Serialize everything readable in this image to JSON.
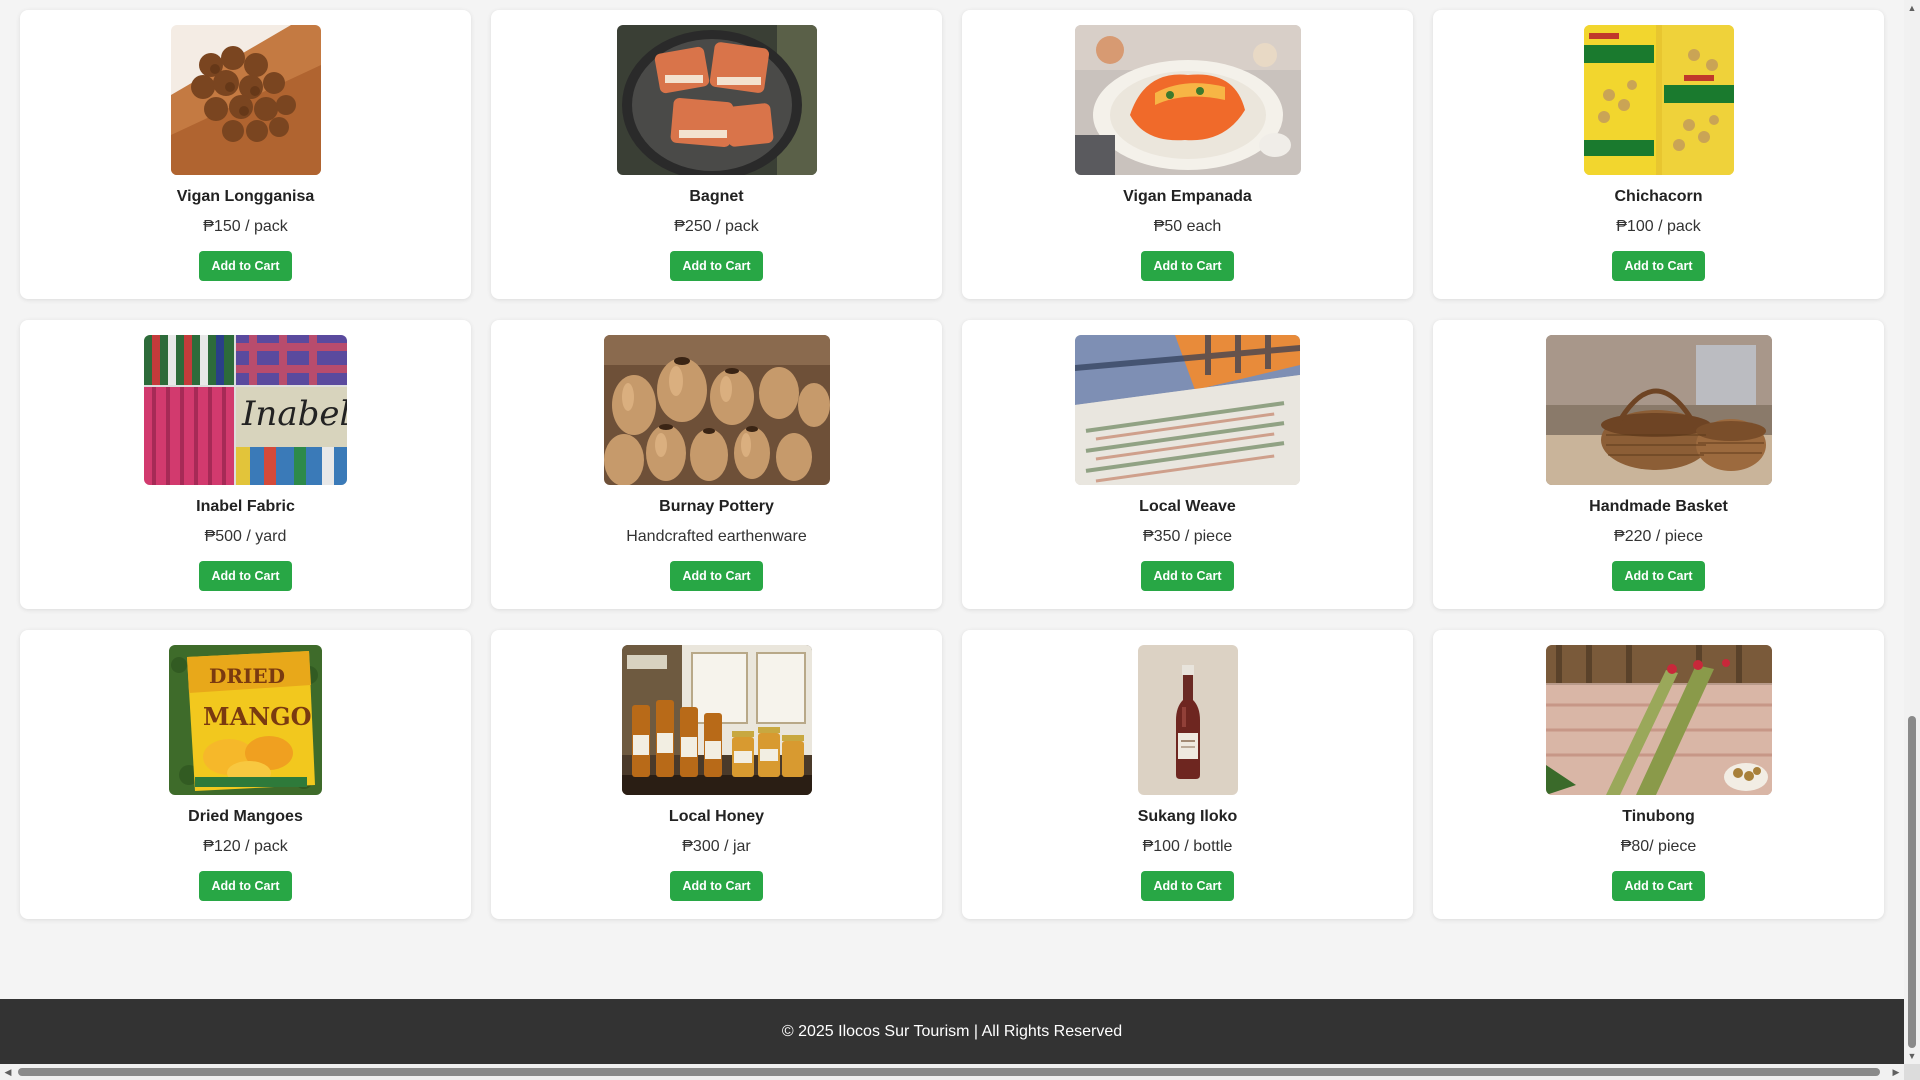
{
  "products": [
    {
      "name": "Vigan Longganisa",
      "price": "₱150 / pack",
      "button": "Add to Cart",
      "image": "sausage-photo"
    },
    {
      "name": "Bagnet",
      "price": "₱250 / pack",
      "button": "Add to Cart",
      "image": "crispy-pork-photo"
    },
    {
      "name": "Vigan Empanada",
      "price": "₱50 each",
      "button": "Add to Cart",
      "image": "empanada-photo"
    },
    {
      "name": "Chichacorn",
      "price": "₱100 / pack",
      "button": "Add to Cart",
      "image": "corn-snack-photo"
    },
    {
      "name": "Inabel Fabric",
      "price": "₱500 / yard",
      "button": "Add to Cart",
      "image": "fabric-photo",
      "image_text": "Inabel"
    },
    {
      "name": "Burnay Pottery",
      "price": "Handcrafted earthenware",
      "button": "Add to Cart",
      "image": "pottery-photo"
    },
    {
      "name": "Local Weave",
      "price": "₱350 / piece",
      "button": "Add to Cart",
      "image": "woven-cloth-photo"
    },
    {
      "name": "Handmade Basket",
      "price": "₱220 / piece",
      "button": "Add to Cart",
      "image": "basket-photo"
    },
    {
      "name": "Dried Mangoes",
      "price": "₱120 / pack",
      "button": "Add to Cart",
      "image": "dried-mango-photo",
      "image_text_1": "DRIED",
      "image_text_2": "MANGO"
    },
    {
      "name": "Local Honey",
      "price": "₱300 / jar",
      "button": "Add to Cart",
      "image": "honey-jars-photo"
    },
    {
      "name": "Sukang Iloko",
      "price": "₱100 / bottle",
      "button": "Add to Cart",
      "image": "vinegar-bottle-photo"
    },
    {
      "name": "Tinubong",
      "price": "₱80/ piece",
      "button": "Add to Cart",
      "image": "bamboo-cake-photo"
    }
  ],
  "footer": {
    "text": "© 2025 Ilocos Sur Tourism | All Rights Reserved"
  },
  "colors": {
    "button": "#28a745",
    "footer": "#333333"
  }
}
